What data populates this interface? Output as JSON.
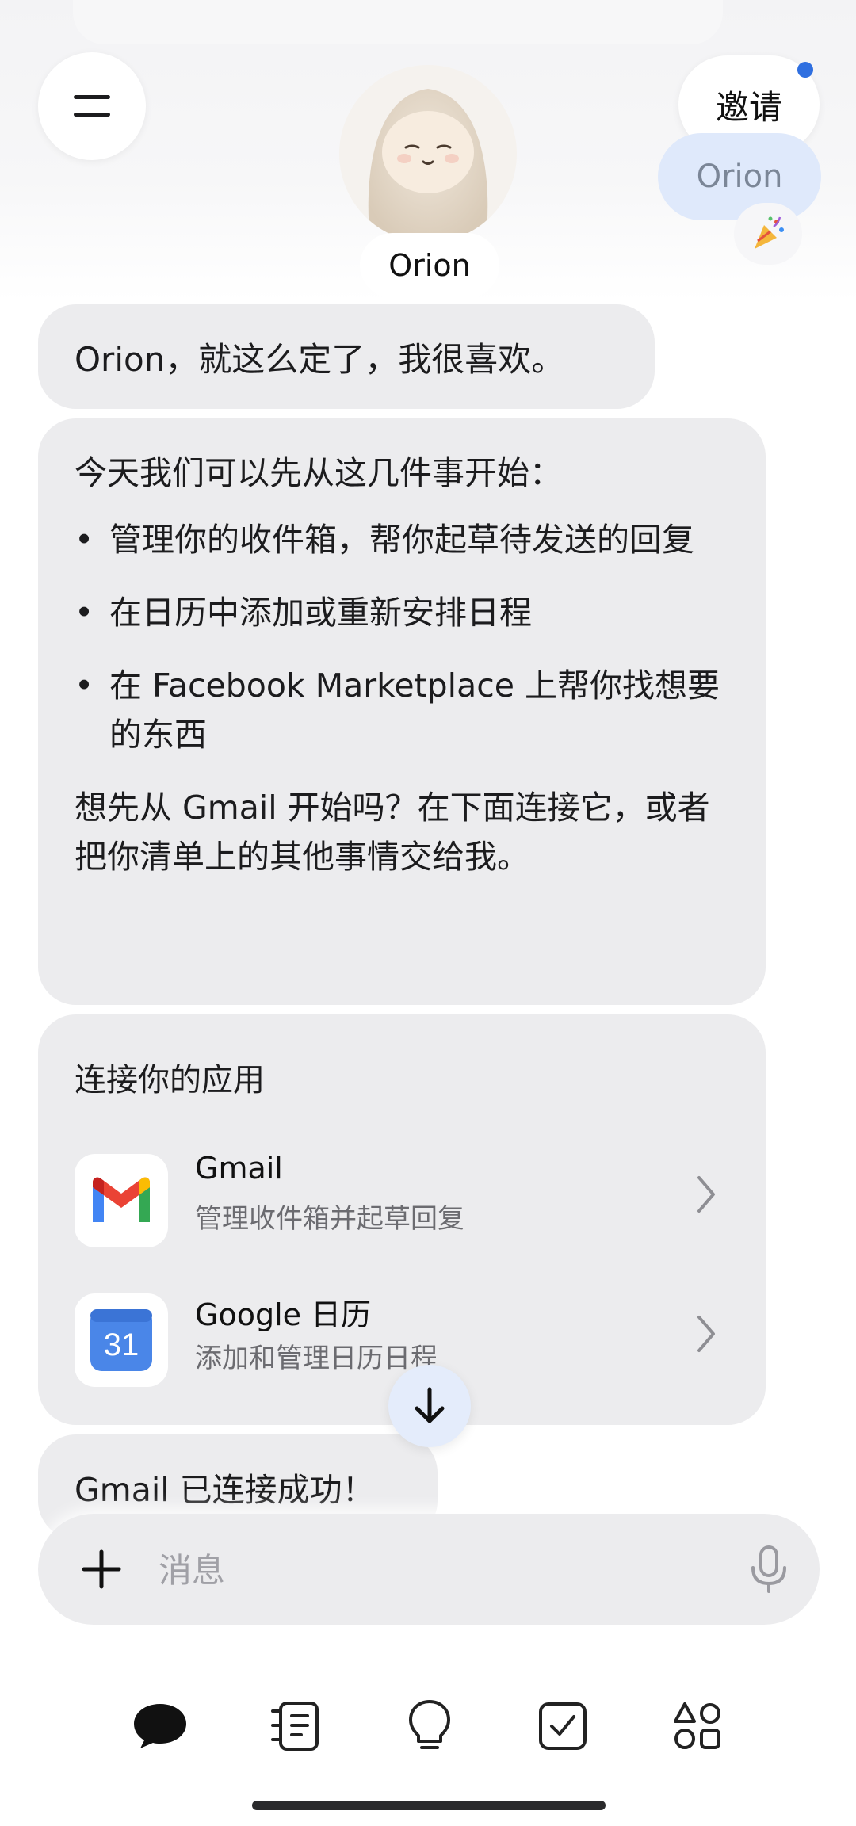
{
  "header": {
    "invite_label": "邀请",
    "contact_pill": "Orion",
    "assistant_name": "Orion",
    "notification_color": "#2f6fe0"
  },
  "messages": [
    {
      "role": "user",
      "text": "Orion，就这么定了，我很喜欢。"
    },
    {
      "role": "assistant",
      "intro": "今天我们可以先从这几件事开始：",
      "items": [
        "管理你的收件箱，帮你起草待发送的回复",
        "在日历中添加或重新安排日程",
        "在 Facebook Marketplace 上帮你找想要的东西"
      ],
      "outro": "想先从 Gmail 开始吗？在下面连接它，或者把你清单上的其他事情交给我。"
    },
    {
      "role": "user",
      "text": "Gmail 已连接成功！"
    }
  ],
  "connect_apps": {
    "title": "连接你的应用",
    "apps": [
      {
        "name": "Gmail",
        "description": "管理收件箱并起草回复",
        "icon": "gmail-icon"
      },
      {
        "name": "Google 日历",
        "description": "添加和管理日历日程",
        "icon": "google-calendar-icon",
        "icon_text": "31"
      }
    ]
  },
  "composer": {
    "placeholder": "消息"
  },
  "bottom_nav": [
    {
      "name": "chat",
      "icon": "chat-bubble-icon",
      "active": true
    },
    {
      "name": "notes",
      "icon": "notebook-icon",
      "active": false
    },
    {
      "name": "ideas",
      "icon": "lightbulb-icon",
      "active": false
    },
    {
      "name": "tasks",
      "icon": "checkbox-icon",
      "active": false
    },
    {
      "name": "apps",
      "icon": "shapes-icon",
      "active": false
    }
  ],
  "colors": {
    "accent": "#2f6fe0",
    "bubble": "#ececee",
    "pill": "#dfe9fb"
  }
}
